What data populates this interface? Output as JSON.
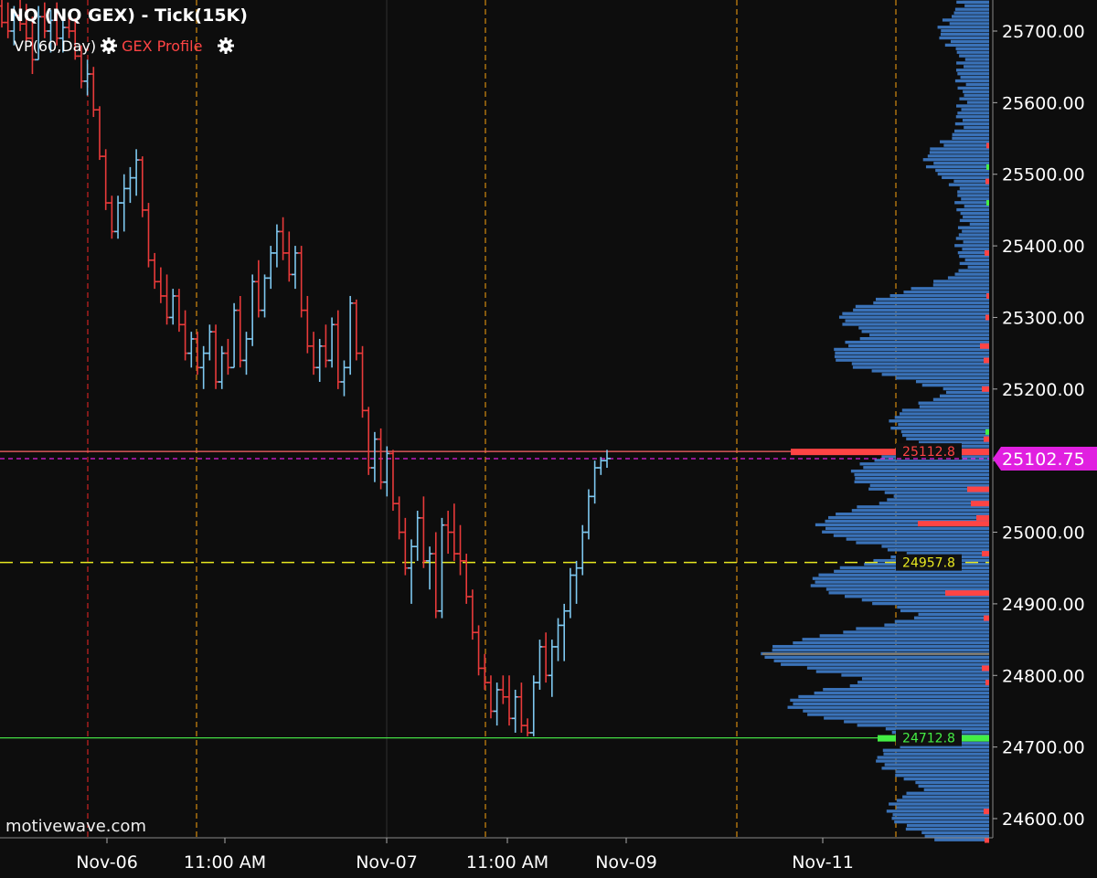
{
  "header": {
    "title": "NQ (NQ GEX) - Tick(15K)",
    "study_vp": "VP(60,Day)",
    "study_gex": "GEX Profile"
  },
  "watermark": "motivewave.com",
  "colors": {
    "background": "#0d0d0d",
    "up_bar": "#7ec8f0",
    "down_bar": "#e83a3a",
    "volume_profile": "#3a72b8",
    "gex_bars": "#ff4444",
    "gex_positive": "#44ee44",
    "current_price_marker": "#e020e0",
    "session_line": "#d48a10",
    "date_line": "#cc2222"
  },
  "chart_data": {
    "type": "candlestick",
    "instrument": "NQ",
    "bar_type": "Tick(15K)",
    "y_axis": {
      "ylim": [
        24570,
        25745
      ],
      "ticks": [
        "24600.00",
        "24700.00",
        "24800.00",
        "24900.00",
        "25000.00",
        "25100.00",
        "25200.00",
        "25300.00",
        "25400.00",
        "25500.00",
        "25600.00",
        "25700.00"
      ]
    },
    "x_axis": {
      "labels": [
        "Nov-06",
        "11:00 AM",
        "Nov-07",
        "11:00 AM",
        "Nov-09",
        "Nov-11"
      ]
    },
    "current_price": "25102.75",
    "levels": [
      {
        "label": "25112.8",
        "value": 25112.8,
        "kind": "gex-call"
      },
      {
        "label": "24957.8",
        "value": 24957.8,
        "kind": "zero-gamma"
      },
      {
        "label": "24712.8",
        "value": 24712.8,
        "kind": "gex-put"
      }
    ],
    "ohlc": [
      [
        25735,
        25748,
        25705,
        25712
      ],
      [
        25712,
        25740,
        25690,
        25700
      ],
      [
        25700,
        25735,
        25680,
        25722
      ],
      [
        25722,
        25745,
        25700,
        25710
      ],
      [
        25710,
        25738,
        25685,
        25690
      ],
      [
        25690,
        25720,
        25640,
        25660
      ],
      [
        25660,
        25735,
        25660,
        25720
      ],
      [
        25720,
        25740,
        25690,
        25700
      ],
      [
        25700,
        25730,
        25670,
        25715
      ],
      [
        25715,
        25740,
        25680,
        25690
      ],
      [
        25690,
        25720,
        25670,
        25705
      ],
      [
        25705,
        25725,
        25690,
        25700
      ],
      [
        25700,
        25718,
        25660,
        25665
      ],
      [
        25665,
        25680,
        25620,
        25630
      ],
      [
        25630,
        25660,
        25610,
        25640
      ],
      [
        25640,
        25650,
        25580,
        25590
      ],
      [
        25590,
        25595,
        25520,
        25525
      ],
      [
        25525,
        25535,
        25450,
        25460
      ],
      [
        25460,
        25470,
        25410,
        25420
      ],
      [
        25420,
        25470,
        25410,
        25460
      ],
      [
        25460,
        25500,
        25420,
        25480
      ],
      [
        25480,
        25510,
        25460,
        25495
      ],
      [
        25495,
        25535,
        25470,
        25520
      ],
      [
        25520,
        25525,
        25440,
        25450
      ],
      [
        25450,
        25460,
        25370,
        25380
      ],
      [
        25380,
        25390,
        25340,
        25350
      ],
      [
        25350,
        25370,
        25320,
        25330
      ],
      [
        25330,
        25360,
        25290,
        25300
      ],
      [
        25300,
        25340,
        25290,
        25330
      ],
      [
        25330,
        25340,
        25280,
        25290
      ],
      [
        25290,
        25310,
        25240,
        25250
      ],
      [
        25250,
        25280,
        25230,
        25270
      ],
      [
        25270,
        25280,
        25220,
        25230
      ],
      [
        25230,
        25260,
        25200,
        25250
      ],
      [
        25250,
        25290,
        25240,
        25280
      ],
      [
        25280,
        25290,
        25200,
        25210
      ],
      [
        25210,
        25260,
        25200,
        25250
      ],
      [
        25250,
        25270,
        25220,
        25230
      ],
      [
        25230,
        25320,
        25230,
        25310
      ],
      [
        25310,
        25330,
        25230,
        25240
      ],
      [
        25240,
        25280,
        25220,
        25270
      ],
      [
        25270,
        25360,
        25260,
        25350
      ],
      [
        25350,
        25380,
        25300,
        25310
      ],
      [
        25310,
        25360,
        25300,
        25355
      ],
      [
        25355,
        25400,
        25340,
        25390
      ],
      [
        25390,
        25430,
        25370,
        25420
      ],
      [
        25420,
        25440,
        25380,
        25390
      ],
      [
        25390,
        25420,
        25350,
        25360
      ],
      [
        25360,
        25400,
        25340,
        25390
      ],
      [
        25390,
        25400,
        25300,
        25310
      ],
      [
        25310,
        25330,
        25250,
        25260
      ],
      [
        25260,
        25280,
        25220,
        25230
      ],
      [
        25230,
        25270,
        25210,
        25260
      ],
      [
        25260,
        25290,
        25230,
        25240
      ],
      [
        25240,
        25300,
        25230,
        25290
      ],
      [
        25290,
        25310,
        25200,
        25210
      ],
      [
        25210,
        25240,
        25190,
        25230
      ],
      [
        25230,
        25330,
        25220,
        25320
      ],
      [
        25320,
        25325,
        25240,
        25250
      ],
      [
        25250,
        25260,
        25160,
        25170
      ],
      [
        25170,
        25175,
        25080,
        25090
      ],
      [
        25090,
        25140,
        25070,
        25130
      ],
      [
        25130,
        25145,
        25060,
        25070
      ],
      [
        25070,
        25120,
        25050,
        25110
      ],
      [
        25110,
        25115,
        25030,
        25040
      ],
      [
        25040,
        25050,
        24990,
        25000
      ],
      [
        25000,
        25020,
        24940,
        24950
      ],
      [
        24950,
        24990,
        24900,
        24980
      ],
      [
        24980,
        25030,
        24960,
        25020
      ],
      [
        25020,
        25050,
        24950,
        24960
      ],
      [
        24960,
        24980,
        24920,
        24970
      ],
      [
        24970,
        25000,
        24880,
        24890
      ],
      [
        24890,
        25020,
        24880,
        25010
      ],
      [
        25010,
        25030,
        24970,
        25000
      ],
      [
        25000,
        25040,
        24960,
        24970
      ],
      [
        24970,
        25010,
        24940,
        24960
      ],
      [
        24960,
        24970,
        24900,
        24910
      ],
      [
        24910,
        24920,
        24850,
        24860
      ],
      [
        24860,
        24870,
        24800,
        24810
      ],
      [
        24810,
        24830,
        24780,
        24790
      ],
      [
        24790,
        24800,
        24740,
        24750
      ],
      [
        24750,
        24790,
        24730,
        24780
      ],
      [
        24780,
        24800,
        24760,
        24770
      ],
      [
        24770,
        24800,
        24730,
        24740
      ],
      [
        24740,
        24780,
        24720,
        24770
      ],
      [
        24770,
        24790,
        24720,
        24730
      ],
      [
        24730,
        24740,
        24715,
        24720
      ],
      [
        24720,
        24800,
        24715,
        24790
      ],
      [
        24790,
        24850,
        24780,
        24840
      ],
      [
        24840,
        24860,
        24790,
        24800
      ],
      [
        24800,
        24850,
        24770,
        24840
      ],
      [
        24840,
        24880,
        24820,
        24870
      ],
      [
        24870,
        24900,
        24820,
        24890
      ],
      [
        24890,
        24950,
        24880,
        24940
      ],
      [
        24940,
        24960,
        24900,
        24950
      ],
      [
        24950,
        25010,
        24940,
        25000
      ],
      [
        25000,
        25060,
        24990,
        25050
      ],
      [
        25050,
        25100,
        25040,
        25090
      ],
      [
        25090,
        25105,
        25080,
        25100
      ],
      [
        25100,
        25115,
        25090,
        25103
      ]
    ],
    "volume_profile_note": "horizontal volume-at-price histogram on right side"
  }
}
